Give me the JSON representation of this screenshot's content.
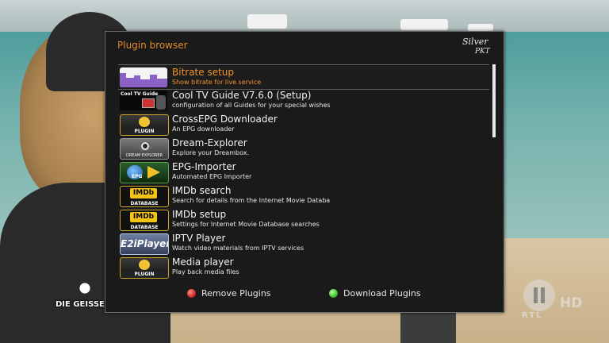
{
  "window": {
    "title": "Plugin browser",
    "brand_line1": "Silver",
    "brand_line2": "PKT"
  },
  "plugins": [
    {
      "name": "Bitrate setup",
      "description": "Show bitrate for live service",
      "icon": "bitrate-chart-icon",
      "selected": true
    },
    {
      "name": "Cool TV Guide V7.6.0 (Setup)",
      "description": "configuration of all Guides for your special wishes",
      "icon": "cool-tv-guide-icon",
      "icon_text": "Cool TV Guide"
    },
    {
      "name": "CrossEPG Downloader",
      "description": "An EPG downloader",
      "icon": "plugin-gear-icon",
      "icon_text": "PLUGIN"
    },
    {
      "name": "Dream-Explorer",
      "description": "Explore your Dreambox.",
      "icon": "dream-explorer-eye-icon",
      "icon_text": "DREAM EXPLORER"
    },
    {
      "name": "EPG-Importer",
      "description": "Automated EPG Importer",
      "icon": "epg-globe-icon",
      "icon_text": "EPG"
    },
    {
      "name": "IMDb search",
      "description": "Search for details from the Internet Movie Databa",
      "icon": "imdb-icon",
      "icon_text": "IMDb",
      "icon_sub": "DATABASE"
    },
    {
      "name": "IMDb setup",
      "description": "Settings for Internet Movie Database searches",
      "icon": "imdb-icon",
      "icon_text": "IMDb",
      "icon_sub": "DATABASE"
    },
    {
      "name": "IPTV Player",
      "description": "Watch video materials from IPTV services",
      "icon": "e2iplayer-icon",
      "icon_text": "E2iPlayer"
    },
    {
      "name": "Media player",
      "description": "Play back media files",
      "icon": "plugin-gear-icon",
      "icon_text": "PLUGIN"
    }
  ],
  "buttons": {
    "remove_label": "Remove Plugins",
    "download_label": "Download Plugins",
    "remove_color": "#d92a2a",
    "download_color": "#3fbf2f"
  },
  "scroll_fraction_visible": 0.34,
  "colors": {
    "accent": "#e08a2a",
    "selected_text": "#f0922e",
    "window_bg": "#1a1a1a"
  },
  "overlay": {
    "channel_logo": "DIE GEISSEN",
    "hd_label": "HD",
    "network_label": "RTL"
  }
}
